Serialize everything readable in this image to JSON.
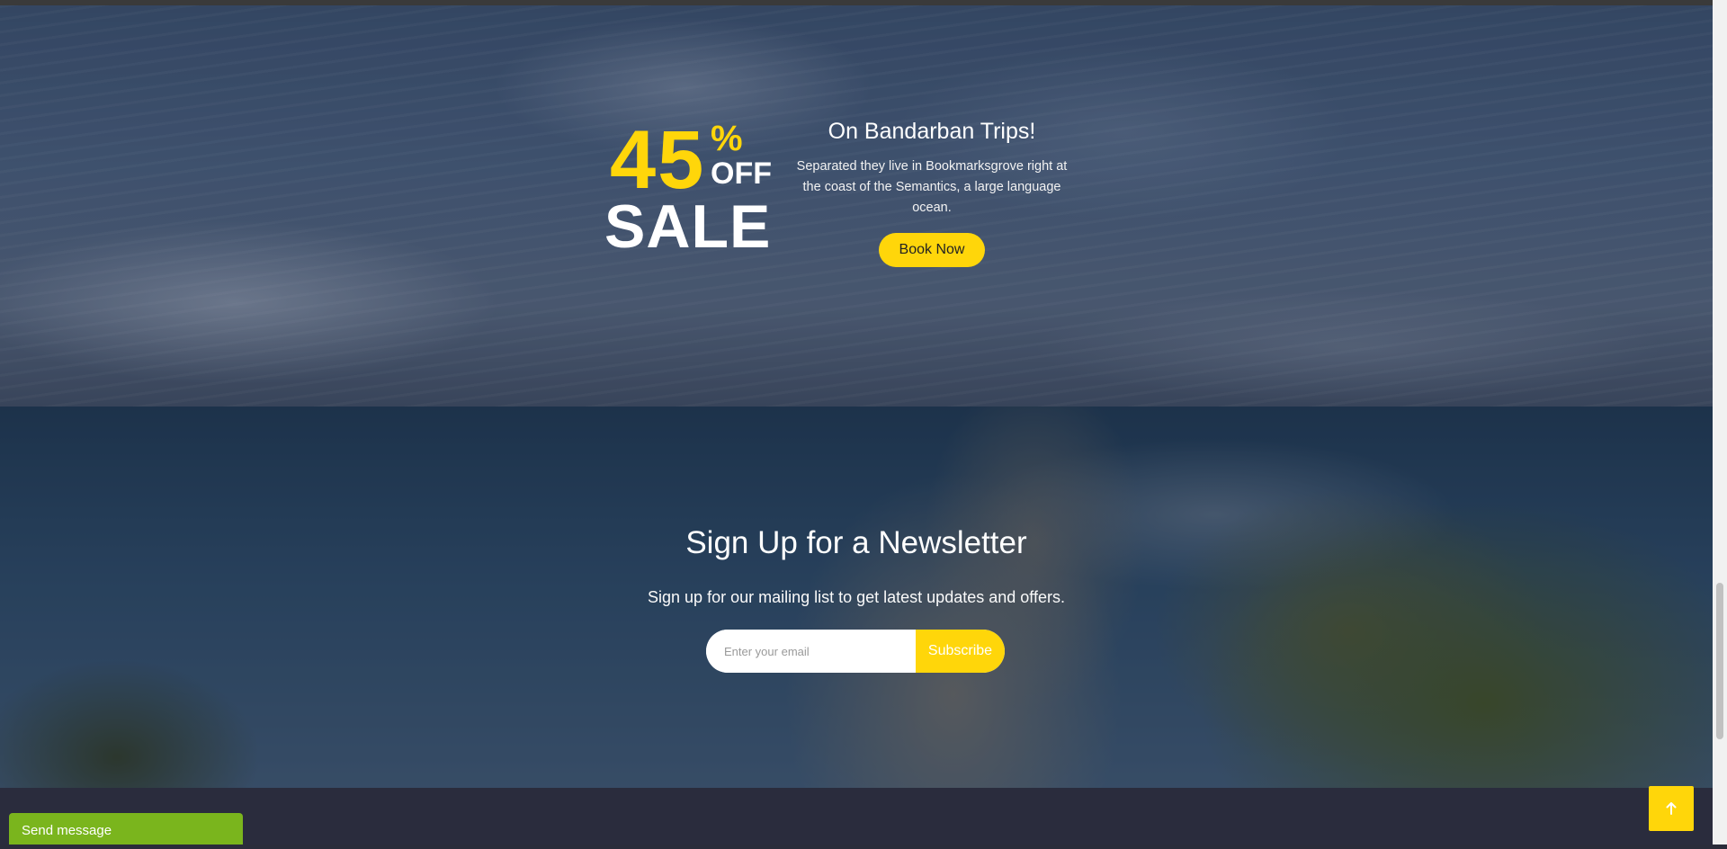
{
  "sale": {
    "number": "45",
    "percent": "%",
    "off": "OFF",
    "word": "SALE",
    "title": "On Bandarban Trips!",
    "description": "Separated they live in Bookmarksgrove right at the coast of the Semantics, a large language ocean.",
    "button_label": "Book Now"
  },
  "newsletter": {
    "title": "Sign Up for a Newsletter",
    "subtitle": "Sign up for our mailing list to get latest updates and offers.",
    "email_placeholder": "Enter your email",
    "email_value": "",
    "subscribe_label": "Subscribe"
  },
  "chat": {
    "label": "Send message"
  },
  "back_to_top": {
    "icon": "arrow-up-icon"
  },
  "colors": {
    "accent": "#ffd60a",
    "chat": "#7ab51d",
    "footer": "#2a2c3d"
  }
}
